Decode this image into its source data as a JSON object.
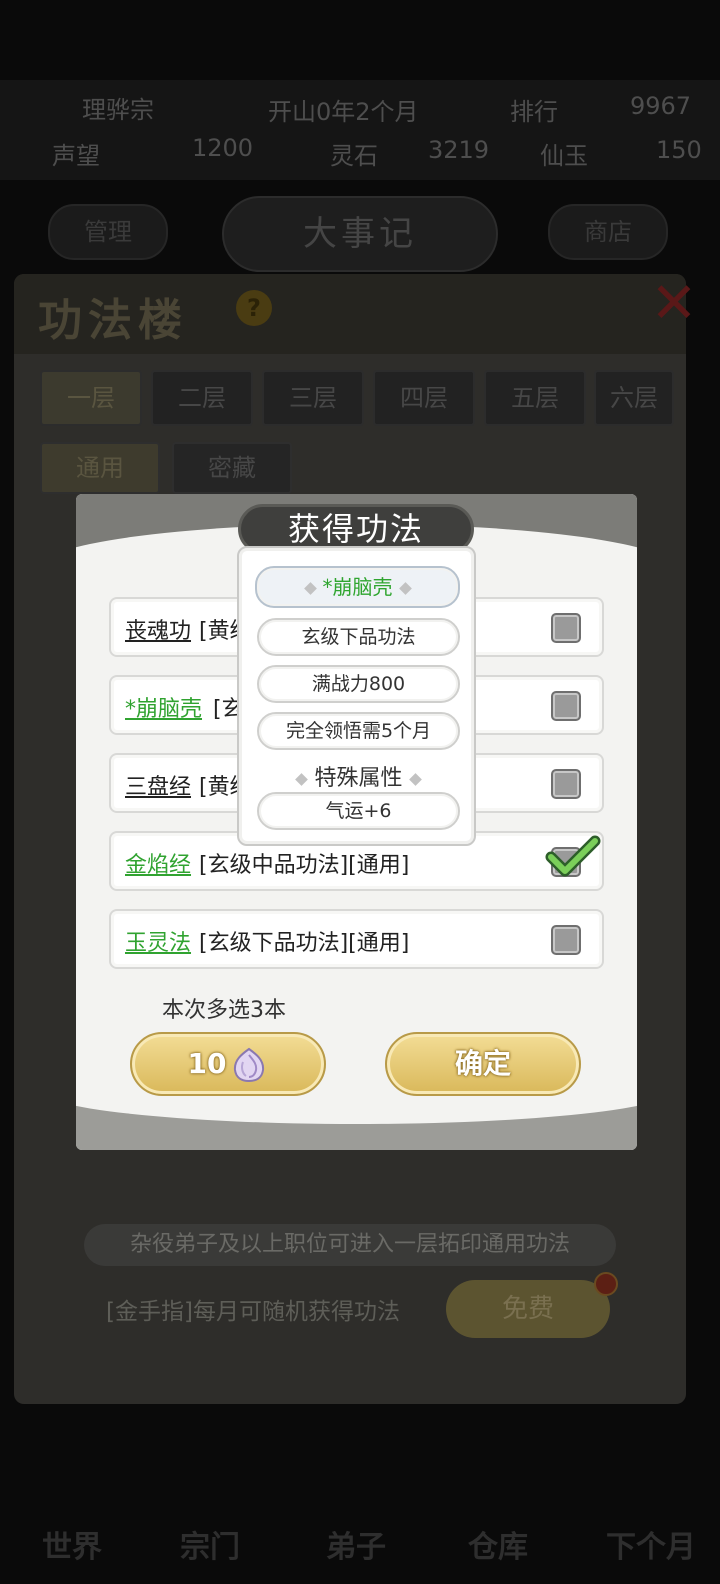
{
  "top_bar": {
    "sect_name": "理骅宗",
    "time_text": "开山0年2个月",
    "ranking_label": "排行",
    "score": "9967",
    "stat1_label": "声望",
    "stat1_value": "1200",
    "stat2_label": "灵石",
    "stat2_value": "3219",
    "stat3_label": "仙玉",
    "stat3_value": "150",
    "left_button": "管理",
    "right_button": "商店",
    "title": "大事记"
  },
  "hall": {
    "title": "功法楼",
    "floors": [
      "一层",
      "二层",
      "三层",
      "四层",
      "五层",
      "六层"
    ],
    "sub_tabs": [
      "通用",
      "密藏"
    ],
    "notice": "杂役弟子及以上职位可进入一层拓印通用功法",
    "golden_finger_text": "[金手指]每月可随机获得功法",
    "free_button": "免费"
  },
  "dialog": {
    "title": "获得功法",
    "items": [
      {
        "name": "丧魂功",
        "tags": "[黄级",
        "checked": false,
        "green": false
      },
      {
        "name": "*崩脑壳",
        "tags": "[玄",
        "checked": false,
        "green": true
      },
      {
        "name": "三盘经",
        "tags": "[黄级",
        "checked": false,
        "green": false
      },
      {
        "name": "金焰经",
        "tags": "[玄级中品功法][通用]",
        "checked": true,
        "green": true
      },
      {
        "name": "玉灵法",
        "tags": "[玄级下品功法][通用]",
        "checked": false,
        "green": true
      }
    ],
    "multi_select_text": "本次多选3本",
    "refresh_cost": "10",
    "confirm_button": "确定"
  },
  "tooltip": {
    "name": "*崩脑壳",
    "grade": "玄级下品功法",
    "power": "满战力800",
    "comprehend": "完全领悟需5个月",
    "section_title": "特殊属性",
    "attribute": "气运+6"
  },
  "bottom_nav": [
    "世界",
    "宗门",
    "弟子",
    "仓库",
    "下个月"
  ],
  "colors": {
    "green_name": "#30a330",
    "gold_button": "#d9b85a",
    "dialog_title_bg": "#3f3f3d"
  }
}
